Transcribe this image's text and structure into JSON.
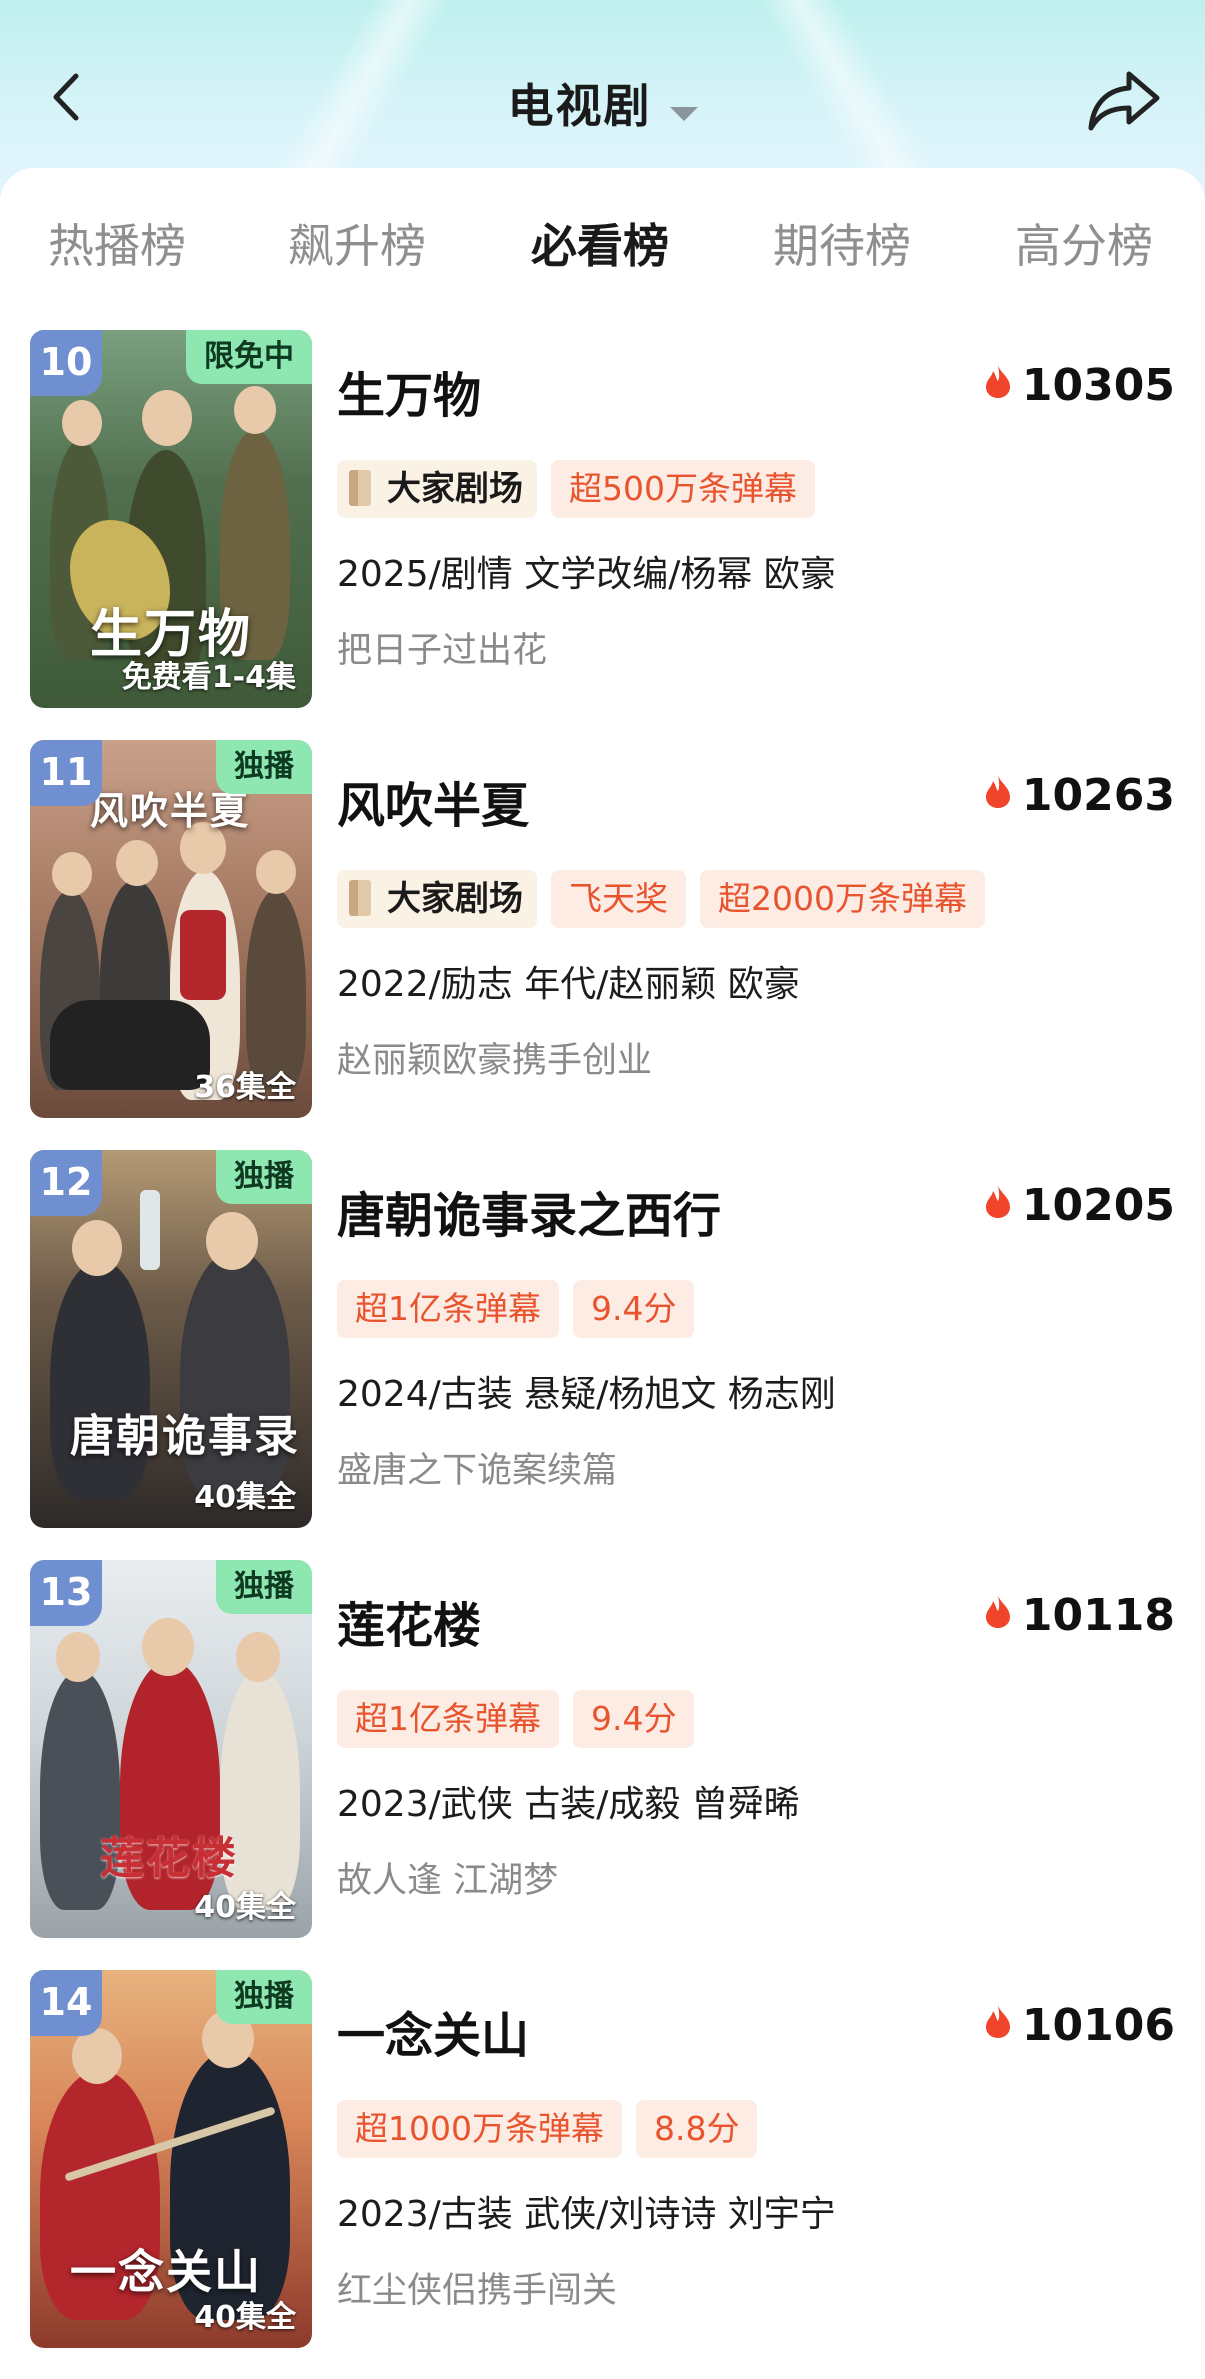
{
  "header": {
    "title": "电视剧",
    "colors": {
      "accent": "#27d07a",
      "heat": "#e8542e",
      "badge_bg": "#fdece4"
    }
  },
  "tabs": [
    {
      "label": "热播榜",
      "active": false
    },
    {
      "label": "飙升榜",
      "active": false
    },
    {
      "label": "必看榜",
      "active": true
    },
    {
      "label": "期待榜",
      "active": false
    },
    {
      "label": "高分榜",
      "active": false
    }
  ],
  "items": [
    {
      "rank": "10",
      "tag": "限免中",
      "episodes": "免费看1-4集",
      "poster_title": "生万物",
      "title": "生万物",
      "heat": "10305",
      "theater": "大家剧场",
      "badges": [
        "超500万条弹幕"
      ],
      "meta": "2025/剧情 文学改编/杨幂 欧豪",
      "desc": "把日子过出花"
    },
    {
      "rank": "11",
      "tag": "独播",
      "episodes": "36集全",
      "poster_title": "风吹半夏",
      "title": "风吹半夏",
      "heat": "10263",
      "theater": "大家剧场",
      "badges": [
        "飞天奖",
        "超2000万条弹幕"
      ],
      "meta": "2022/励志 年代/赵丽颖 欧豪",
      "desc": "赵丽颖欧豪携手创业"
    },
    {
      "rank": "12",
      "tag": "独播",
      "episodes": "40集全",
      "poster_title": "唐朝诡事录",
      "title": "唐朝诡事录之西行",
      "heat": "10205",
      "theater": "",
      "badges": [
        "超1亿条弹幕",
        "9.4分"
      ],
      "meta": "2024/古装 悬疑/杨旭文 杨志刚",
      "desc": "盛唐之下诡案续篇"
    },
    {
      "rank": "13",
      "tag": "独播",
      "episodes": "40集全",
      "poster_title": "莲花楼",
      "title": "莲花楼",
      "heat": "10118",
      "theater": "",
      "badges": [
        "超1亿条弹幕",
        "9.4分"
      ],
      "meta": "2023/武侠 古装/成毅 曾舜晞",
      "desc": "故人逢 江湖梦"
    },
    {
      "rank": "14",
      "tag": "独播",
      "episodes": "40集全",
      "poster_title": "一念关山",
      "title": "一念关山",
      "heat": "10106",
      "theater": "",
      "badges": [
        "超1000万条弹幕",
        "8.8分"
      ],
      "meta": "2023/古装 武侠/刘诗诗 刘宇宁",
      "desc": "红尘侠侣携手闯关"
    }
  ]
}
